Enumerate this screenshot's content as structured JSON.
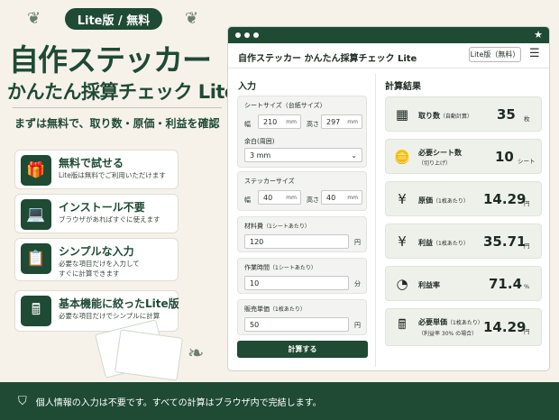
{
  "promo": {
    "badge": "Lite版 / 無料",
    "title_line1": "自作ステッカー",
    "title_line2": "かんたん採算チェック Lite",
    "tagline": "まずは無料で、取り数・原価・利益を確認",
    "features": [
      {
        "icon": "gift-icon",
        "glyph": "🎁",
        "title": "無料で試せる",
        "desc1": "Lite版は無料でご利用いただけます",
        "desc2": ""
      },
      {
        "icon": "laptop-icon",
        "glyph": "💻",
        "title": "インストール不要",
        "desc1": "ブラウザがあればすぐに使えます",
        "desc2": ""
      },
      {
        "icon": "clipboard-icon",
        "glyph": "📋",
        "title": "シンプルな入力",
        "desc1": "必要な項目だけを入力して",
        "desc2": "すぐに計算できます"
      },
      {
        "icon": "calculator-icon",
        "glyph": "🖩",
        "title": "基本機能に絞ったLite版",
        "desc1": "必要な項目だけでシンプルに計算",
        "desc2": ""
      }
    ]
  },
  "footer": {
    "text": "個人情報の入力は不要です。すべての計算はブラウザ内で完結します。"
  },
  "window": {
    "title": "自作ステッカー かんたん採算チェック Lite",
    "lite_button": "Lite版（無料）",
    "input": {
      "section_title": "入力",
      "sheet_size_label": "シートサイズ（台紙サイズ）",
      "width_label": "幅",
      "height_label": "高さ",
      "sheet_width": "210",
      "sheet_height": "297",
      "unit_mm": "mm",
      "margin_label": "余白(周囲)",
      "margin_value": "3 mm",
      "sticker_size_label": "ステッカーサイズ",
      "sticker_width": "40",
      "sticker_height": "40",
      "material_label": "材料費",
      "material_sub": "（1シートあたり）",
      "material_value": "120",
      "material_unit": "円",
      "work_time_label": "作業時間",
      "work_time_sub": "（1シートあたり）",
      "work_time_value": "10",
      "work_time_unit": "分",
      "price_label": "販売単価",
      "price_sub": "（1枚あたり）",
      "price_value": "50",
      "price_unit": "円",
      "calc_button": "計算する"
    },
    "results": {
      "section_title": "計算結果",
      "items": [
        {
          "icon": "grid-icon",
          "glyph": "▦",
          "label": "取り数",
          "label_sub": "（自動計算）",
          "sub": "",
          "value": "35",
          "unit": "枚"
        },
        {
          "icon": "coins-icon",
          "glyph": "🪙",
          "label": "必要シート数",
          "label_sub": "",
          "sub": "（切り上げ）",
          "value": "10",
          "unit": "シート"
        },
        {
          "icon": "yen-icon",
          "glyph": "¥",
          "label": "原価",
          "label_sub": "（1枚あたり）",
          "sub": "",
          "value": "14.29",
          "unit": "円"
        },
        {
          "icon": "yen-icon",
          "glyph": "¥",
          "label": "利益",
          "label_sub": "（1枚あたり）",
          "sub": "",
          "value": "35.71",
          "unit": "円"
        },
        {
          "icon": "pie-chart-icon",
          "glyph": "◔",
          "label": "利益率",
          "label_sub": "",
          "sub": "",
          "value": "71.4",
          "unit": "%"
        },
        {
          "icon": "calculator-icon",
          "glyph": "🖩",
          "label": "必要単価",
          "label_sub": "（1枚あたり）",
          "sub": "（利益率 30% の場合）",
          "value": "14.29",
          "unit": "円"
        }
      ]
    }
  }
}
